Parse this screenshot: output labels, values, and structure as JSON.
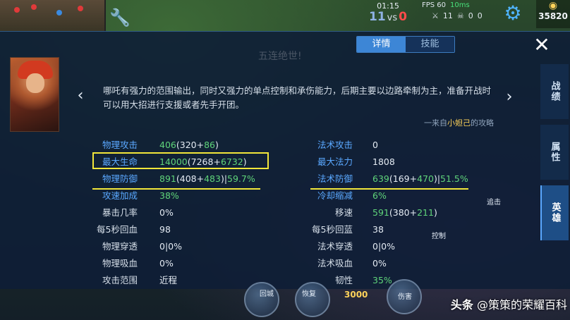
{
  "hud": {
    "clock": "01:15",
    "score_blue": "11",
    "score_vs": "vs",
    "score_red": "0",
    "fps": "FPS 60",
    "ping": "10ms",
    "kda": "11",
    "deaths": "0",
    "assists": "0",
    "gold": "35820"
  },
  "tabs": {
    "details": "详情",
    "skills": "技能"
  },
  "watermark_top": "五连绝世!",
  "hero": {
    "description": "哪吒有强力的范围输出，同时又强力的单点控制和承伤能力，后期主要以边路牵制为主，准备开战时可以用大招进行支援或者先手开团。",
    "quote_prefix": "一来自",
    "quote_author": "小妲己",
    "quote_suffix": "的攻略"
  },
  "side_tabs": [
    "战绩",
    "属性",
    "英雄"
  ],
  "stats_left": [
    {
      "label": "物理攻击",
      "value_main": "406",
      "value_base": "(320+",
      "value_bonus": "86",
      "value_close": ")",
      "pct": ""
    },
    {
      "label": "最大生命",
      "value_main": "14000",
      "value_base": "(7268+",
      "value_bonus": "6732",
      "value_close": ")",
      "pct": ""
    },
    {
      "label": "物理防御",
      "value_main": "891",
      "value_base": "(408+",
      "value_bonus": "483",
      "value_close": ")|",
      "pct": "59.7%"
    },
    {
      "label": "攻速加成",
      "value_main": "38%",
      "value_base": "",
      "value_bonus": "",
      "value_close": "",
      "pct": ""
    },
    {
      "label": "暴击几率",
      "value_main": "0%",
      "value_base": "",
      "value_bonus": "",
      "value_close": "",
      "pct": ""
    },
    {
      "label": "每5秒回血",
      "value_main": "98",
      "value_base": "",
      "value_bonus": "",
      "value_close": "",
      "pct": ""
    },
    {
      "label": "物理穿透",
      "value_main": "0|0%",
      "value_base": "",
      "value_bonus": "",
      "value_close": "",
      "pct": ""
    },
    {
      "label": "物理吸血",
      "value_main": "0%",
      "value_base": "",
      "value_bonus": "",
      "value_close": "",
      "pct": ""
    },
    {
      "label": "攻击范围",
      "value_main": "近程",
      "value_base": "",
      "value_bonus": "",
      "value_close": "",
      "pct": ""
    }
  ],
  "stats_right": [
    {
      "label": "法术攻击",
      "value_main": "0",
      "value_base": "",
      "value_bonus": "",
      "value_close": "",
      "pct": ""
    },
    {
      "label": "最大法力",
      "value_main": "1808",
      "value_base": "",
      "value_bonus": "",
      "value_close": "",
      "pct": ""
    },
    {
      "label": "法术防御",
      "value_main": "639",
      "value_base": "(169+",
      "value_bonus": "470",
      "value_close": ")|",
      "pct": "51.5%"
    },
    {
      "label": "冷却缩减",
      "value_main": "6%",
      "value_base": "",
      "value_bonus": "",
      "value_close": "",
      "pct": ""
    },
    {
      "label": "移速",
      "value_main": "591",
      "value_base": "(380+",
      "value_bonus": "211",
      "value_close": ")",
      "pct": ""
    },
    {
      "label": "每5秒回蓝",
      "value_main": "38",
      "value_base": "",
      "value_bonus": "",
      "value_close": "",
      "pct": ""
    },
    {
      "label": "法术穿透",
      "value_main": "0|0%",
      "value_base": "",
      "value_bonus": "",
      "value_close": "",
      "pct": ""
    },
    {
      "label": "法术吸血",
      "value_main": "0%",
      "value_base": "",
      "value_bonus": "",
      "value_close": "",
      "pct": ""
    },
    {
      "label": "韧性",
      "value_main": "35%",
      "value_base": "",
      "value_bonus": "",
      "value_close": "",
      "pct": ""
    }
  ],
  "hud_bottom": {
    "recall": "回城",
    "heal": "恢复",
    "gold_cost": "3000",
    "damage": "伤害",
    "control": "控制",
    "chase": "追击"
  },
  "footer": {
    "brand": "头条",
    "handle": "@策策的荣耀百科"
  },
  "colors": {
    "accent_blue": "#5aa8ff",
    "bonus_green": "#5fd47a",
    "highlight_yellow": "#f2e63a",
    "panel_bg": "#0e1e36"
  },
  "icons": [
    "wrench-icon",
    "gear-icon",
    "close-icon",
    "chevron-left-icon",
    "chevron-right-icon",
    "coin-icon"
  ]
}
